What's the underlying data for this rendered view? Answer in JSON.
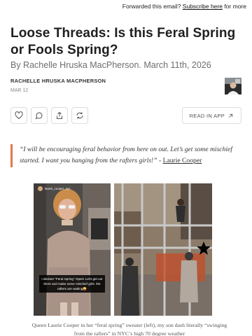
{
  "forward_bar": {
    "prefix": "Forwarded this email?",
    "link": "Subscribe here",
    "suffix": "for more"
  },
  "post": {
    "title": "Loose Threads: Is this Feral Spring or Fools Spring?",
    "subtitle": "By Rachelle Hruska MacPherson. March 11th, 2026",
    "author": "RACHELLE HRUSKA MACPHERSON",
    "date": "MAR 12"
  },
  "actions": {
    "like_icon": "heart-icon",
    "comment_icon": "comment-icon",
    "share_icon": "share-icon",
    "restack_icon": "restack-icon",
    "read_in_app": "READ IN APP"
  },
  "quote": {
    "text": "“I will be encouraging feral behavior from here on out. Let’s get some mischief started. I want you hanging from the rafters girls!”",
    "dash": " - ",
    "author_link": "Laurie Cooper"
  },
  "photo_left": {
    "username": "laurie_cooper_nyc",
    "overlay_text": "I declare \"Feral Spring\" Open! Let's get out there and make some mischief girls. the rafters are waiting😜"
  },
  "caption": "Queen Laurie Cooper in her “feral spring” sweater (left), my son dash literally “swinging from the rafters” in NYC’s high 70 degree weather",
  "colors": {
    "accent": "#e2774a",
    "text": "#1f1f1f",
    "muted": "#6e6e6e"
  }
}
